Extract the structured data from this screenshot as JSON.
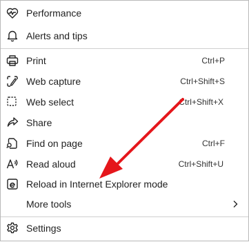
{
  "menu": {
    "items": [
      {
        "label": "Performance",
        "icon": "heartbeat-icon"
      },
      {
        "label": "Alerts and tips",
        "icon": "bell-icon"
      },
      {
        "label": "Print",
        "shortcut": "Ctrl+P",
        "icon": "printer-icon"
      },
      {
        "label": "Web capture",
        "shortcut": "Ctrl+Shift+S",
        "icon": "web-capture-icon"
      },
      {
        "label": "Web select",
        "shortcut": "Ctrl+Shift+X",
        "icon": "web-select-icon"
      },
      {
        "label": "Share",
        "icon": "share-icon"
      },
      {
        "label": "Find on page",
        "shortcut": "Ctrl+F",
        "icon": "find-on-page-icon"
      },
      {
        "label": "Read aloud",
        "shortcut": "Ctrl+Shift+U",
        "icon": "read-aloud-icon"
      },
      {
        "label": "Reload in Internet Explorer mode",
        "icon": "internet-explorer-icon"
      },
      {
        "label": "More tools",
        "icon": "chevron-right-icon"
      },
      {
        "label": "Settings",
        "icon": "gear-icon"
      }
    ]
  },
  "colors": {
    "arrow": "#e5161b",
    "text": "#1f1f1f",
    "divider": "#cfcfcf"
  }
}
